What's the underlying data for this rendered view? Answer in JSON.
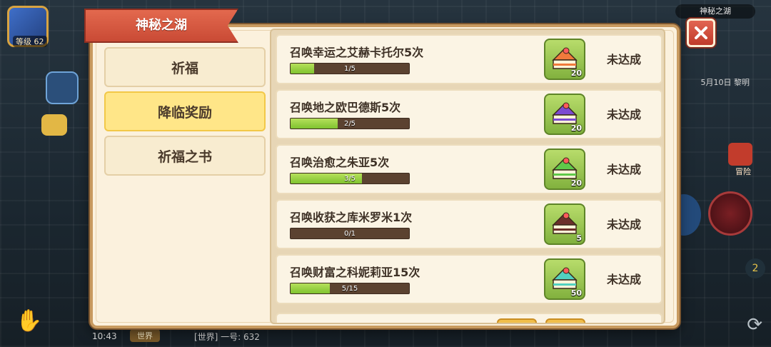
{
  "hud": {
    "level": "等级 62",
    "time": "10:43",
    "world_tab": "世界",
    "world_message": "[世界] 一号: 632",
    "map_label": "神秘之湖",
    "date": "5月10日 黎明",
    "adventure_label": "冒险",
    "side_number": "2"
  },
  "dialog": {
    "title": "神秘之湖",
    "tabs": [
      {
        "label": "祈福",
        "active": false
      },
      {
        "label": "降临奖励",
        "active": true
      },
      {
        "label": "祈福之书",
        "active": false
      }
    ],
    "tasks": [
      {
        "title": "召唤幸运之艾赫卡托尔5次",
        "progress_text": "1/5",
        "progress": 0.2,
        "reward_count": "20",
        "reward_icon": "orange-cake-icon",
        "cake_color": "#f07a3c",
        "status": "未达成"
      },
      {
        "title": "召唤地之欧巴德斯5次",
        "progress_text": "2/5",
        "progress": 0.4,
        "reward_count": "20",
        "reward_icon": "purple-cake-icon",
        "cake_color": "#7c4ad1",
        "status": "未达成"
      },
      {
        "title": "召唤治愈之朱亚5次",
        "progress_text": "3/5",
        "progress": 0.6,
        "reward_count": "20",
        "reward_icon": "green-cake-icon",
        "cake_color": "#5fc94a",
        "status": "未达成"
      },
      {
        "title": "召唤收获之库米罗米1次",
        "progress_text": "0/1",
        "progress": 0.0,
        "reward_count": "5",
        "reward_icon": "chocolate-cake-icon",
        "cake_color": "#6b2f2a",
        "status": "未达成"
      },
      {
        "title": "召唤财富之科妮莉亚15次",
        "progress_text": "5/15",
        "progress": 0.333,
        "reward_count": "50",
        "reward_icon": "teal-cake-icon",
        "cake_color": "#52d1c0",
        "status": "未达成"
      }
    ]
  },
  "colors": {
    "title_banner": "#d4553d",
    "active_tab": "#ffe688",
    "progress_fill": "#8fd13a",
    "progress_track": "#5b4230",
    "close_button": "#d44d3a"
  }
}
